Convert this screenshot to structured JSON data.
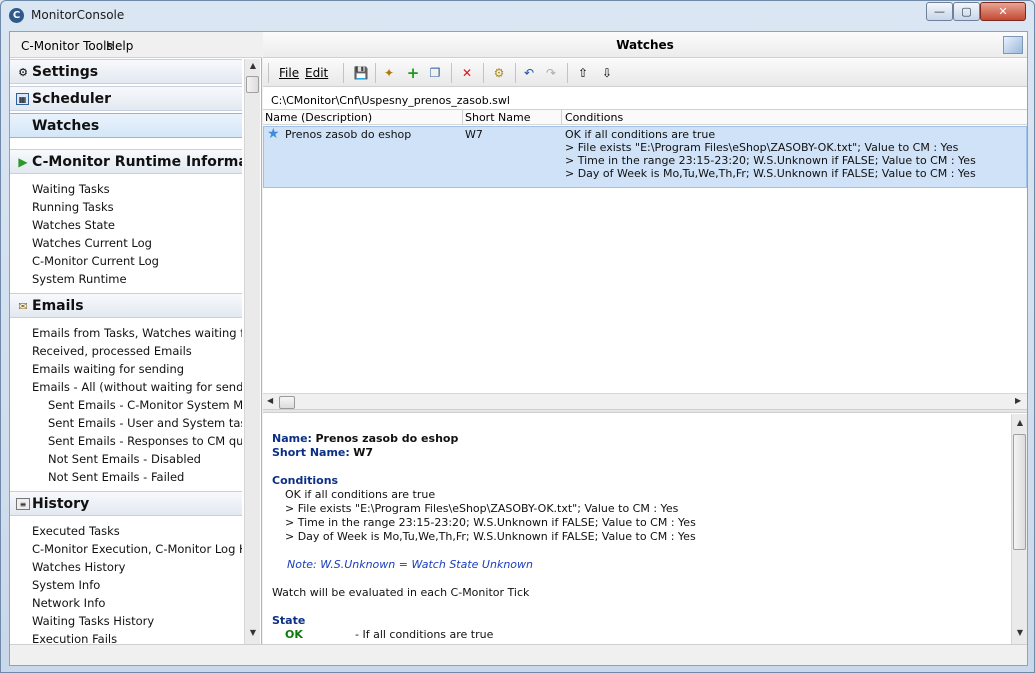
{
  "window": {
    "title": "MonitorConsole",
    "min": "—",
    "max": "▢",
    "close": "✕"
  },
  "left": {
    "menu": [
      "C-Monitor Tools",
      "Help"
    ],
    "sections": [
      {
        "icon": "gear-icon",
        "label": "Settings"
      },
      {
        "icon": "scheduler-icon",
        "label": "Scheduler"
      },
      {
        "icon": "",
        "label": "Watches"
      },
      {
        "icon": "play-icon",
        "label": "C-Monitor Runtime Information"
      },
      {
        "icon": "envelope-icon",
        "label": "Emails"
      },
      {
        "icon": "history-icon",
        "label": "History"
      }
    ],
    "runtime_items": [
      "Waiting Tasks",
      "Running Tasks",
      "Watches State",
      "Watches Current Log",
      "C-Monitor Current Log",
      "System Runtime"
    ],
    "email_items": [
      "Emails from Tasks, Watches waiting for send",
      "Received, processed Emails",
      "Emails waiting for sending",
      "Emails - All (without waiting for sending)"
    ],
    "email_sub_items": [
      "Sent Emails - C-Monitor System Message",
      "Sent Emails - User and System tasks Res",
      "Sent Emails - Responses to CM queries",
      "Not Sent Emails - Disabled",
      "Not Sent Emails - Failed"
    ],
    "history_items": [
      "Executed Tasks",
      "C-Monitor Execution, C-Monitor Log History",
      "Watches History",
      "System Info",
      "Network Info",
      "Waiting Tasks History",
      "Execution Fails"
    ]
  },
  "right": {
    "title": "Watches",
    "toolbar": {
      "file": "File",
      "edit": "Edit"
    },
    "path": "C:\\CMonitor\\Cnf\\Uspesny_prenos_zasob.swl",
    "columns": [
      "Name (Description)",
      "Short Name",
      "Conditions"
    ],
    "row": {
      "name": "Prenos zasob do eshop",
      "short": "W7",
      "conditions": [
        "OK if all conditions are true",
        "> File exists \"E:\\Program Files\\eShop\\ZASOBY-OK.txt\"; Value to CM : Yes",
        "> Time in the range 23:15-23:20; W.S.Unknown if FALSE; Value to CM : Yes",
        "> Day of Week is Mo,Tu,We,Th,Fr; W.S.Unknown if FALSE; Value to CM : Yes"
      ]
    },
    "detail": {
      "name_label": "Name:",
      "name_value": "Prenos zasob do eshop",
      "short_label": "Short Name:",
      "short_value": "W7",
      "conditions_heading": "Conditions",
      "conditions": [
        "OK if all conditions are true",
        "> File exists \"E:\\Program Files\\eShop\\ZASOBY-OK.txt\"; Value to CM : Yes",
        "> Time in the range 23:15-23:20; W.S.Unknown if FALSE; Value to CM : Yes",
        "> Day of Week is Mo,Tu,We,Th,Fr; W.S.Unknown if FALSE; Value to CM : Yes"
      ],
      "note": "Note: W.S.Unknown = Watch State Unknown",
      "eval": "Watch will be evaluated in each C-Monitor Tick",
      "state_heading": "State",
      "state_ok": "OK",
      "state_ok_desc": "- If all conditions are true"
    }
  }
}
